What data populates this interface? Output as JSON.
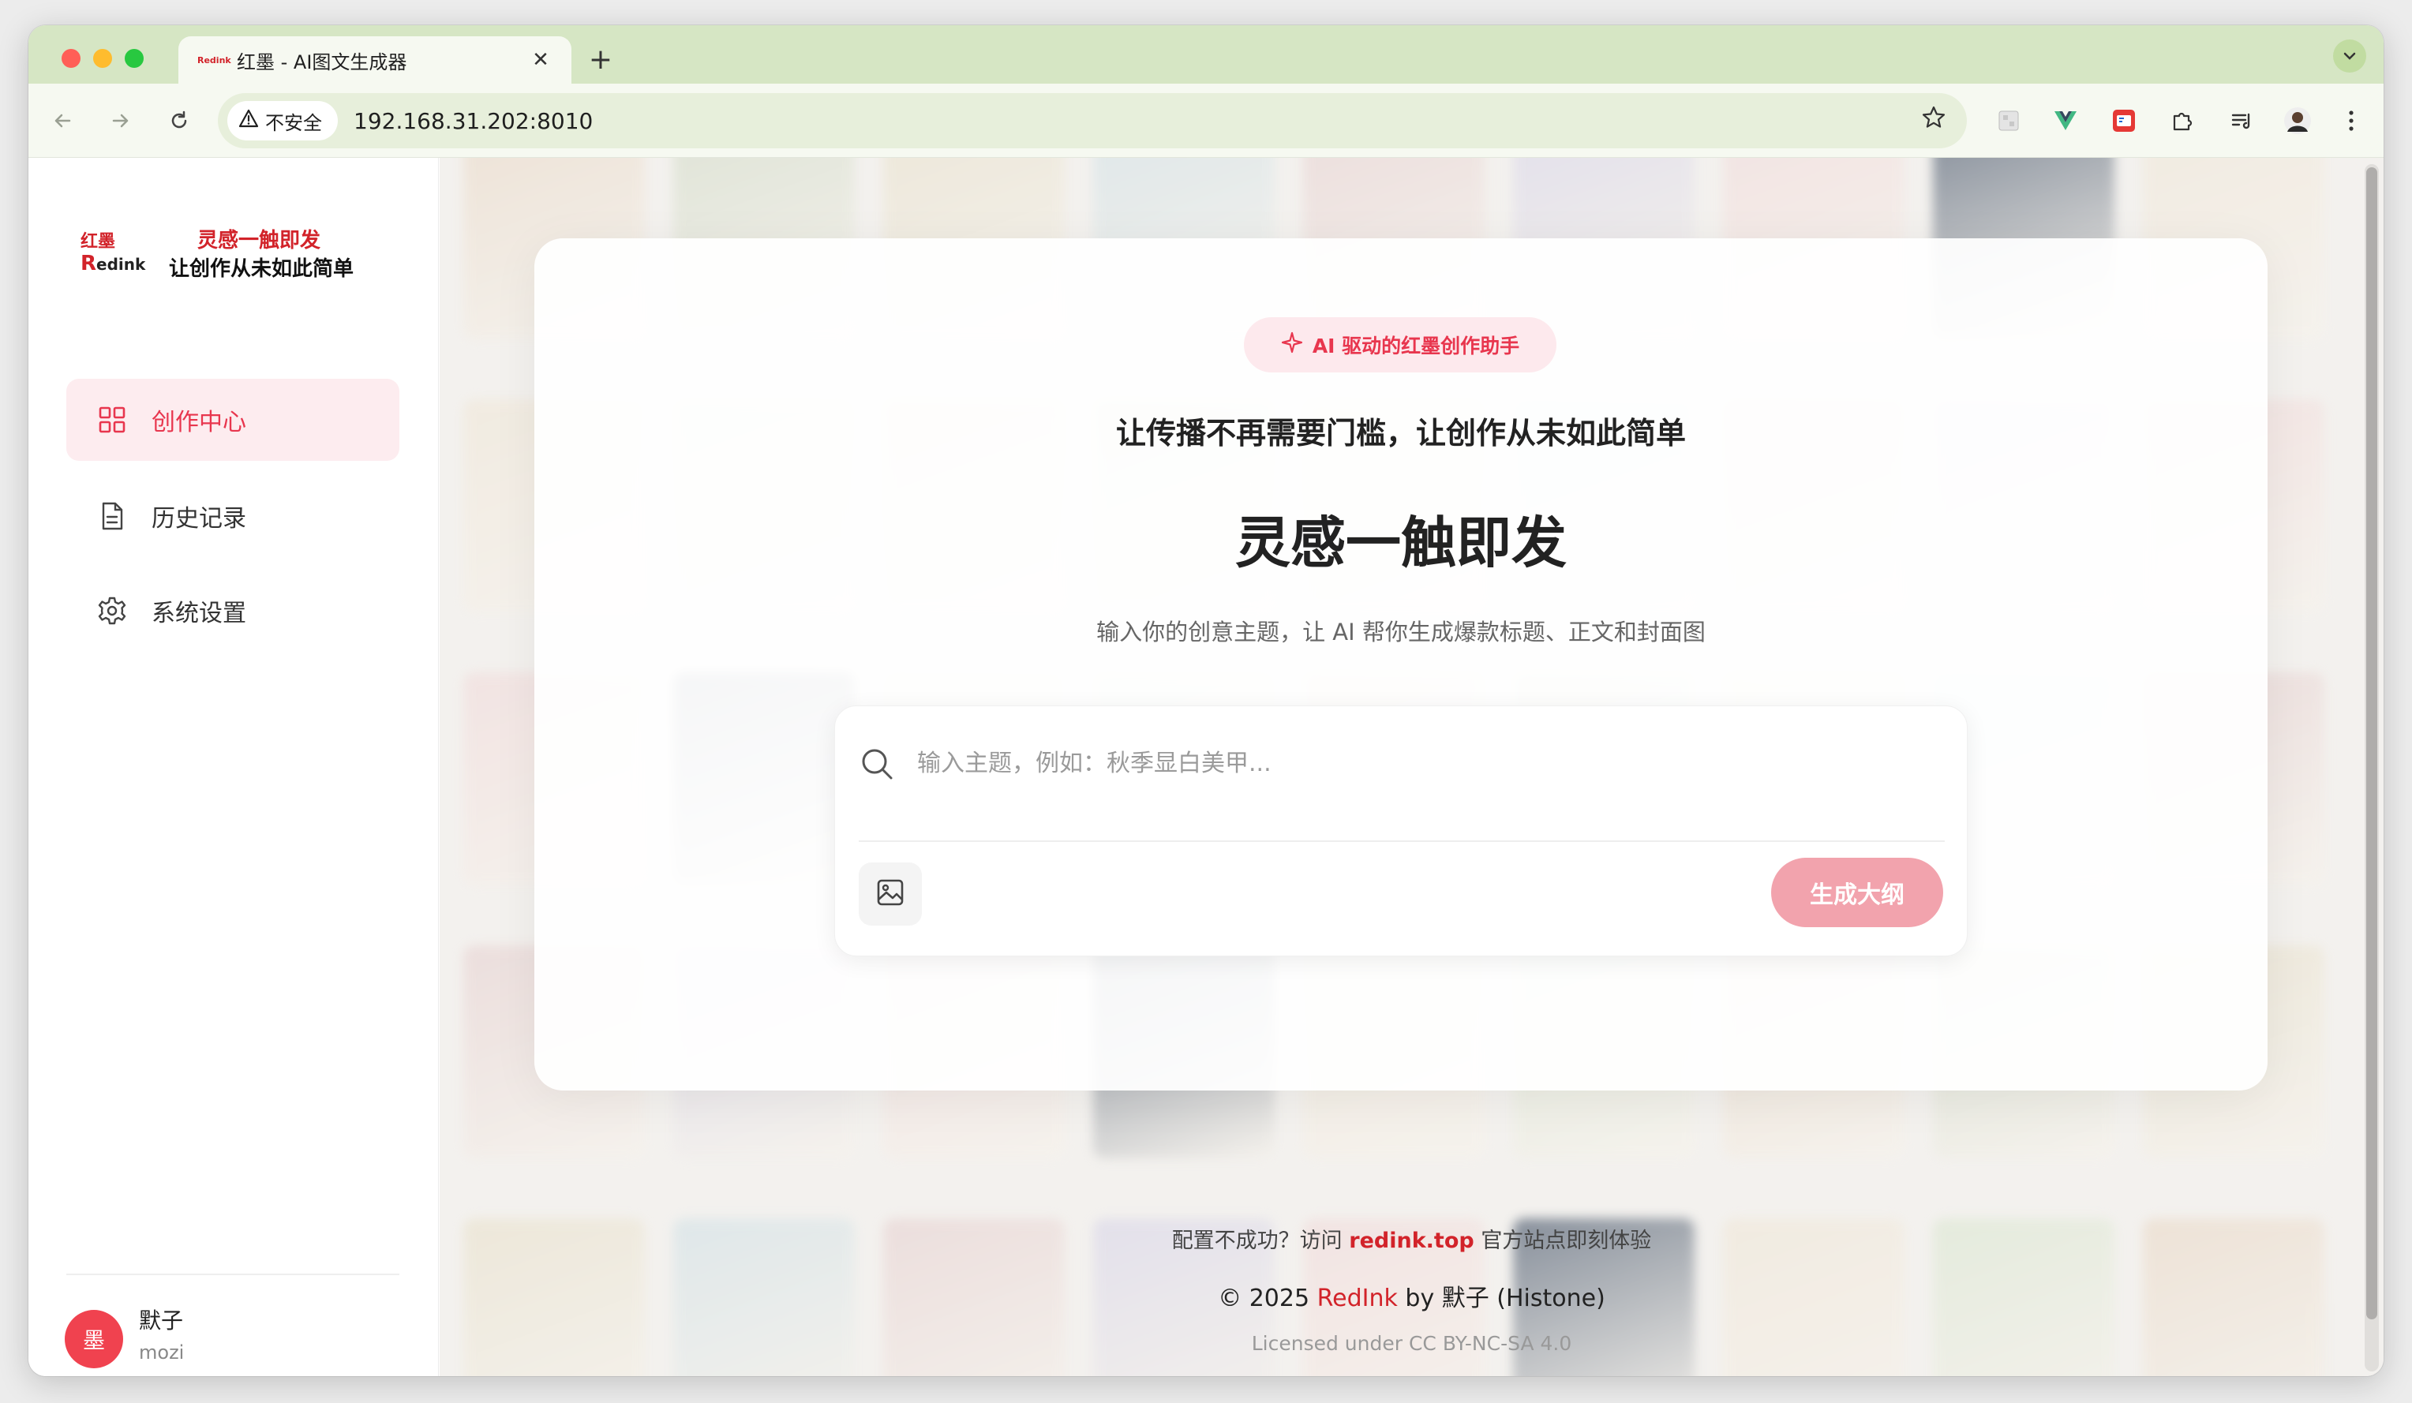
{
  "browser": {
    "tab_title": "红墨 - AI图文生成器",
    "tab_favicon_text": "Redink",
    "security_label": "不安全",
    "url": "192.168.31.202:8010",
    "close_glyph": "✕",
    "new_tab_glyph": "+"
  },
  "sidebar": {
    "logo_line1": "红墨",
    "logo_line2_r": "R",
    "logo_line2_rest": "edink",
    "brand_line1": "灵感一触即发",
    "brand_line2": "让创作从未如此简单",
    "items": [
      {
        "label": "创作中心",
        "icon": "grid-icon",
        "active": true
      },
      {
        "label": "历史记录",
        "icon": "document-icon",
        "active": false
      },
      {
        "label": "系统设置",
        "icon": "gear-icon",
        "active": false
      }
    ],
    "user": {
      "avatar_text": "墨",
      "name": "默子",
      "id": "mozi"
    }
  },
  "main": {
    "badge": "AI 驱动的红墨创作助手",
    "tagline": "让传播不再需要门槛，让创作从未如此简单",
    "hero_title": "灵感一触即发",
    "subtitle": "输入你的创意主题，让 AI 帮你生成爆款标题、正文和封面图",
    "input_placeholder": "输入主题，例如：秋季显白美甲...",
    "generate_label": "生成大纲"
  },
  "footer": {
    "line1_prefix": "配置不成功？访问",
    "line1_link": "redink.top",
    "line1_suffix": "官方站点即刻体验",
    "line2_prefix": "© 2025",
    "line2_brand": "RedInk",
    "line2_suffix": "by 默子 (Histone)",
    "line3": "Licensed under CC BY-NC-SA 4.0"
  },
  "colors": {
    "accent": "#e8364e",
    "brand_red": "#d2232a",
    "button_disabled": "#f2a3ad"
  }
}
